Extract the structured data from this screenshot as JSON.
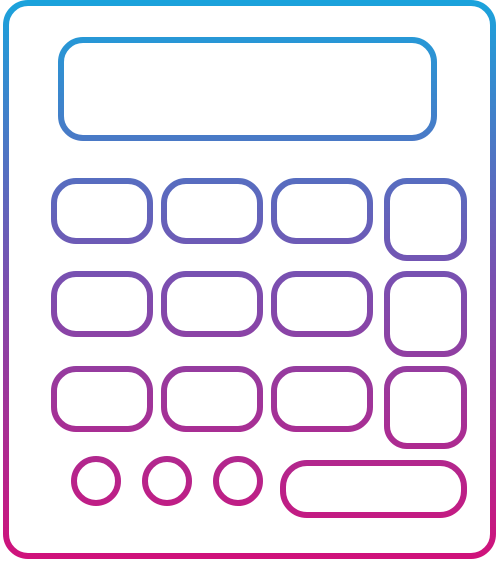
{
  "icon": {
    "name": "calculator-icon",
    "gradient": {
      "top_color": "#1aa3dc",
      "middle_color": "#7a4fb0",
      "bottom_color": "#d1117a"
    },
    "background": "#ffffff",
    "display": "blank",
    "keys": {
      "rectangular_rows": 3,
      "keys_per_row": 4,
      "round_keys": 3,
      "wide_key": 1
    }
  }
}
